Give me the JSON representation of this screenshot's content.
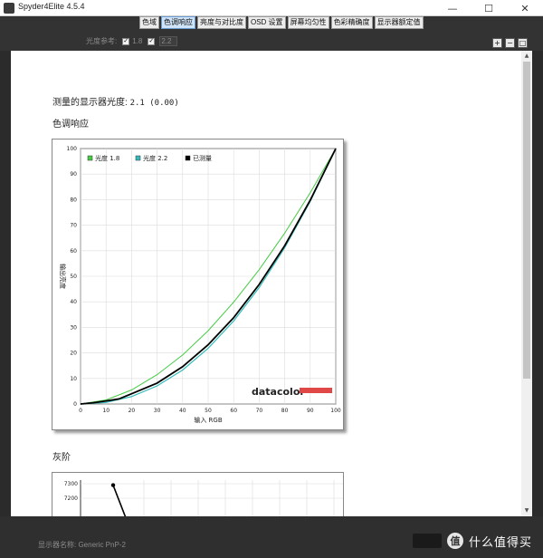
{
  "window": {
    "title": "Spyder4Elite 4.5.4",
    "min_glyph": "—",
    "max_glyph": "☐",
    "close_glyph": "✕"
  },
  "tabs": [
    {
      "label": "色域",
      "active": false
    },
    {
      "label": "色调响应",
      "active": true
    },
    {
      "label": "亮度与对比度",
      "active": false
    },
    {
      "label": "OSD 设置",
      "active": false
    },
    {
      "label": "屏幕均匀性",
      "active": false
    },
    {
      "label": "色彩精确度",
      "active": false
    },
    {
      "label": "显示器额定值",
      "active": false
    }
  ],
  "gamma_ref": {
    "label": "光度参考:",
    "opt1_label": "1.8",
    "opt2_value": "2.2",
    "check_glyph": "✓"
  },
  "zoom": {
    "zoom_in": "+",
    "zoom_out": "−",
    "zoom_fit": "□"
  },
  "content": {
    "measured_label": "测量的显示器光度:",
    "measured_value": "2.1 (0.00)",
    "section_tone": "色调响应",
    "section_gray": "灰阶"
  },
  "footer": {
    "display_name": "显示器名称: Generic PnP-2"
  },
  "watermark": {
    "logo_char": "值",
    "text": "什么值得买"
  },
  "colors": {
    "gamma18": "#44cc44",
    "gamma22": "#33bbbb",
    "measured": "#000000",
    "datacolor_bar": "#e04848"
  },
  "chart_data": [
    {
      "type": "line",
      "title": "",
      "xlabel": "输入 RGB",
      "ylabel": "输出亮度",
      "xlim": [
        0,
        100
      ],
      "ylim": [
        0,
        100
      ],
      "x_ticks": [
        0,
        10,
        20,
        30,
        40,
        50,
        60,
        70,
        80,
        90,
        100
      ],
      "y_ticks": [
        0,
        10,
        20,
        30,
        40,
        50,
        60,
        70,
        80,
        90,
        100
      ],
      "grid": true,
      "legend_position": "top-left",
      "brand": "datacolor",
      "series": [
        {
          "name": "光度 1.8",
          "color": "#44cc44",
          "x": [
            0,
            10,
            20,
            30,
            40,
            50,
            60,
            70,
            80,
            90,
            100
          ],
          "y": [
            0,
            1.6,
            5.5,
            11.5,
            19.2,
            28.7,
            39.9,
            52.6,
            66.9,
            82.7,
            100
          ]
        },
        {
          "name": "光度 2.2",
          "color": "#33bbbb",
          "x": [
            0,
            10,
            20,
            30,
            40,
            50,
            60,
            70,
            80,
            90,
            100
          ],
          "y": [
            0,
            0.6,
            2.9,
            7.1,
            13.3,
            21.8,
            32.5,
            45.6,
            61.2,
            79.3,
            100
          ]
        },
        {
          "name": "已测量",
          "color": "#000000",
          "x": [
            0,
            5,
            10,
            15,
            20,
            30,
            40,
            50,
            60,
            70,
            80,
            90,
            100
          ],
          "y": [
            0,
            0.5,
            1.2,
            2.0,
            4.0,
            8.2,
            14.6,
            23.2,
            33.8,
            46.8,
            62.0,
            79.8,
            100
          ]
        }
      ]
    },
    {
      "type": "line",
      "title": "",
      "y_ticks": [
        7300,
        7200
      ],
      "grid": true,
      "series": [
        {
          "name": "",
          "color": "#000000",
          "x": [
            0,
            3
          ],
          "y": [
            7290,
            7000
          ]
        }
      ]
    }
  ]
}
